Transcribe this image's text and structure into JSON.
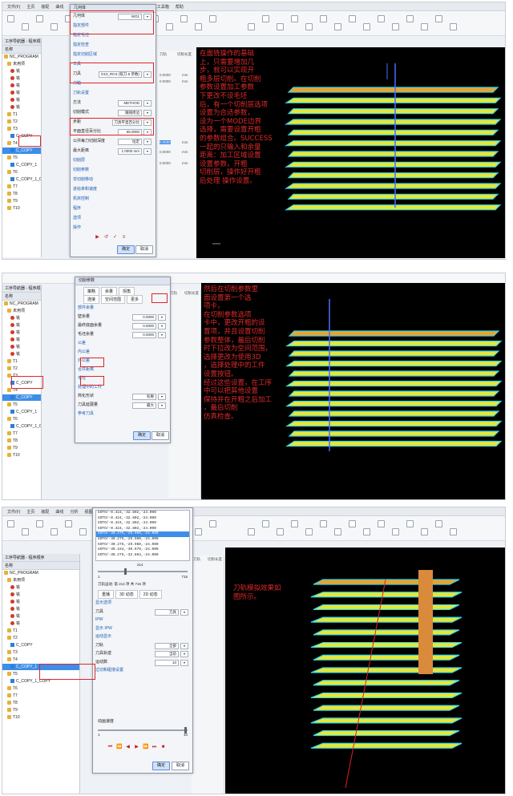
{
  "panel1": {
    "menus": [
      "文件(F)",
      "主页",
      "装配",
      "曲线",
      "分析",
      "视图",
      "渲染",
      "工具",
      "应用模块",
      "NX 工具箱",
      "帮助"
    ],
    "navigator": {
      "title": "工序导航器 - 程序顺序",
      "column": "名称",
      "items": [
        {
          "label": "NC_PROGRAM",
          "kind": "root"
        },
        {
          "label": "未用项",
          "kind": "fold"
        },
        {
          "label": "铣",
          "kind": "op"
        },
        {
          "label": "铣",
          "kind": "op"
        },
        {
          "label": "铣",
          "kind": "op"
        },
        {
          "label": "铣",
          "kind": "op"
        },
        {
          "label": "铣",
          "kind": "op"
        },
        {
          "label": "铣",
          "kind": "op"
        },
        {
          "label": "T1",
          "kind": "fold"
        },
        {
          "label": "T2",
          "kind": "fold"
        },
        {
          "label": "T3",
          "kind": "fold"
        },
        {
          "label": "C_COPY",
          "kind": "op"
        },
        {
          "label": "T4",
          "kind": "fold"
        },
        {
          "label": "C_COPY",
          "kind": "op",
          "selected": true
        },
        {
          "label": "T5",
          "kind": "fold"
        },
        {
          "label": "C_COPY_1",
          "kind": "op"
        },
        {
          "label": "T6",
          "kind": "fold"
        },
        {
          "label": "C_COPY_1_COPY",
          "kind": "op"
        },
        {
          "label": "T7",
          "kind": "fold"
        },
        {
          "label": "T8",
          "kind": "fold"
        },
        {
          "label": "T9",
          "kind": "fold"
        },
        {
          "label": "T10",
          "kind": "fold"
        }
      ]
    },
    "columns": [
      "刀轨",
      "切削长度"
    ],
    "col_values": [
      "0.0000",
      "0.0000",
      "0.0000",
      "0.0000",
      "0.0000",
      "0.0000"
    ],
    "col_units": [
      "mm",
      "mm",
      "mm",
      "mm",
      "mm",
      "mm"
    ],
    "dialog": {
      "title": "几何体",
      "rows": [
        {
          "label": "几何体",
          "value": "WO1"
        },
        {
          "label": "指定部件",
          "value": ""
        },
        {
          "label": "指定毛坯",
          "value": ""
        },
        {
          "label": "指定检查",
          "value": ""
        },
        {
          "label": "指定切削区域",
          "value": ""
        },
        {
          "label": "工具",
          "value": ""
        },
        {
          "label": "刀具",
          "value": "D10_R0.5 (铣刀-5 参数)"
        },
        {
          "label": "刀轴",
          "value": ""
        },
        {
          "label": "刀轨设置",
          "value": ""
        },
        {
          "label": "方法",
          "value": "METHOD"
        },
        {
          "label": "切削模式",
          "value": "跟随周边"
        },
        {
          "label": "步距",
          "value": "刀具平直百分比"
        },
        {
          "label": "平面直径百分比",
          "value": "65.0000"
        },
        {
          "label": "公共每刀切削深度",
          "value": "恒定"
        },
        {
          "label": "最大距离",
          "value": "1.0000 mm"
        },
        {
          "label": "切削层",
          "value": ""
        },
        {
          "label": "切削参数",
          "value": ""
        },
        {
          "label": "非切削移动",
          "value": ""
        },
        {
          "label": "进给率和速度",
          "value": ""
        },
        {
          "label": "机床控制",
          "value": ""
        },
        {
          "label": "程序",
          "value": ""
        },
        {
          "label": "选项",
          "value": ""
        },
        {
          "label": "操作",
          "value": ""
        }
      ],
      "ok": "确定",
      "cancel": "取消"
    },
    "note": "在面铣操作的基础\n上，只需要增加几\n步，就可以实现开\n粗多层切削。在切削\n参数设置加工参数\n下更改不设毛坯\n后，有一个切削层选项\n设置为合适参数，\n设为一个MODE边界\n选择，需要设置开粗\n的参数组合。SUCCESS\n一起的只输入和余量\n距离：加工区域设置\n设置参数，开粗\n切削层，操作好开粗\n后处理 操作设置。"
  },
  "panel2": {
    "navigator": {
      "title": "工序导航器 - 程序顺序",
      "column": "名称",
      "items": [
        {
          "label": "NC_PROGRAM",
          "kind": "root"
        },
        {
          "label": "未用项",
          "kind": "fold"
        },
        {
          "label": "铣",
          "kind": "op"
        },
        {
          "label": "铣",
          "kind": "op"
        },
        {
          "label": "铣",
          "kind": "op"
        },
        {
          "label": "铣",
          "kind": "op"
        },
        {
          "label": "铣",
          "kind": "op"
        },
        {
          "label": "铣",
          "kind": "op"
        },
        {
          "label": "T1",
          "kind": "fold"
        },
        {
          "label": "T2",
          "kind": "fold"
        },
        {
          "label": "T3",
          "kind": "fold"
        },
        {
          "label": "C_COPY",
          "kind": "op"
        },
        {
          "label": "T4",
          "kind": "fold"
        },
        {
          "label": "C_COPY",
          "kind": "op",
          "selected": true
        },
        {
          "label": "T5",
          "kind": "fold"
        },
        {
          "label": "C_COPY_1",
          "kind": "op"
        },
        {
          "label": "T6",
          "kind": "fold"
        },
        {
          "label": "C_COPY_1_COPY",
          "kind": "op"
        },
        {
          "label": "T7",
          "kind": "fold"
        },
        {
          "label": "T8",
          "kind": "fold"
        },
        {
          "label": "T9",
          "kind": "fold"
        },
        {
          "label": "T10",
          "kind": "fold"
        }
      ]
    },
    "columns": [
      "刀轨",
      "切削长度"
    ],
    "dialog": {
      "title": "切削参数",
      "tabs_row1": [
        "策略",
        "余量",
        "拐角"
      ],
      "tabs_row2": [
        "连接",
        "空间范围",
        "更多"
      ],
      "rows": [
        {
          "label": "部件余量",
          "value": ""
        },
        {
          "label": "壁余量",
          "value": "0.0000"
        },
        {
          "label": "最终底面余量",
          "value": "0.0000"
        },
        {
          "label": "毛坯余量",
          "value": "0.0000"
        },
        {
          "label": "公差",
          "value": ""
        },
        {
          "label": "内公差",
          "value": ""
        },
        {
          "label": "外公差",
          "value": ""
        },
        {
          "label": "合并距离",
          "value": ""
        },
        {
          "label": "毛坯",
          "value": ""
        },
        {
          "label": "处理中的工件",
          "value": ""
        },
        {
          "label": "简化形状",
          "value": "轮廓"
        },
        {
          "label": "刀具延展量",
          "value": "最大"
        },
        {
          "label": "参考刀具",
          "value": ""
        }
      ],
      "ok": "确定",
      "cancel": "取消"
    },
    "note": "然后在切削参数里\n面设置第一个选\n项卡，\n在切削参数选项\n卡中，更改开粗的设\n置项，并且设置切削\n参数整体，最后切削\n时下拉改为空间范围，\n选择更改为使用3D\n，选择处理中的工件\n设置按钮。\n经过这些设置，在工序\n中可以把其他设置\n保持并在开粗之后加工\n，最后切削\n仿真检查。"
  },
  "panel3": {
    "menus": [
      "文件(F)",
      "主页",
      "装配",
      "曲线",
      "分析",
      "视图",
      "渲染",
      "工具",
      "应用模块",
      "NX 工具箱",
      "帮助"
    ],
    "navigator": {
      "title": "工序导航器 - 程序顺序",
      "column": "名称",
      "items": [
        {
          "label": "NC_PROGRAM",
          "kind": "root"
        },
        {
          "label": "未用项",
          "kind": "fold"
        },
        {
          "label": "铣",
          "kind": "op"
        },
        {
          "label": "铣",
          "kind": "op"
        },
        {
          "label": "铣",
          "kind": "op"
        },
        {
          "label": "铣",
          "kind": "op"
        },
        {
          "label": "铣",
          "kind": "op"
        },
        {
          "label": "铣",
          "kind": "op"
        },
        {
          "label": "T1",
          "kind": "fold"
        },
        {
          "label": "T2",
          "kind": "fold"
        },
        {
          "label": "C_COPY",
          "kind": "op"
        },
        {
          "label": "T3",
          "kind": "fold"
        },
        {
          "label": "T4",
          "kind": "fold"
        },
        {
          "label": "C_COPY_1",
          "kind": "op",
          "selected": true
        },
        {
          "label": "T5",
          "kind": "fold"
        },
        {
          "label": "C_COPY_1_COPY",
          "kind": "op"
        },
        {
          "label": "T6",
          "kind": "fold"
        },
        {
          "label": "T7",
          "kind": "fold"
        },
        {
          "label": "T8",
          "kind": "fold"
        },
        {
          "label": "T9",
          "kind": "fold"
        },
        {
          "label": "T10",
          "kind": "fold"
        }
      ]
    },
    "columns": [
      "刀轨",
      "切削长度"
    ],
    "dialog": {
      "title": "刀轨可视化",
      "listing": [
        "GOTO/-0.424,-32.802,-24.000",
        "GOTO/-0.424,-32.802,-24.000",
        "GOTO/-0.424,-32.802,-24.000",
        "GOTO/-0.424,-32.802,-24.000",
        "GOTO/-30.275,-29.960,-24.000",
        "GOTO/-30.275,-29.960,-24.000",
        "GOTO/-30.275,-29.960,-24.000",
        "GOTO/-30.164,-30.679,-24.000",
        "GOTO/-30.275,-32.864,-24.000"
      ],
      "selected_index": 4,
      "slider_label": "214",
      "slider_min": "1",
      "slider_max": "715",
      "status": "刀轨运动: 第 214 项 共 715 项",
      "tabs": [
        "重播",
        "3D 动态",
        "2D 动态"
      ],
      "rows": [
        {
          "label": "显示选项",
          "value": ""
        },
        {
          "label": "刀具",
          "value": "刀具"
        },
        {
          "label": "IPW",
          "value": ""
        },
        {
          "label": "显示 IPW",
          "value": ""
        },
        {
          "label": "运动显示",
          "value": ""
        },
        {
          "label": "刀轨",
          "value": "全部"
        },
        {
          "label": "刀具轨迹",
          "value": "当前"
        },
        {
          "label": "运动数",
          "value": "10"
        },
        {
          "label": "过切和碰撞设置",
          "value": ""
        }
      ],
      "speed_label": "动画速度",
      "speed_min": "1",
      "speed_max": "10",
      "vcr": [
        "⏮",
        "⏪",
        "◀",
        "▶",
        "⏩",
        "⏭",
        "■"
      ],
      "ok": "确定",
      "cancel": "取消"
    },
    "note": "刀轨模拟效果如\n图所示。"
  },
  "colors": {
    "accent_red": "#e0242b",
    "selection_blue": "#3d8ee8",
    "viewport_bg": "#000000",
    "part_yellow": "#e8e636",
    "toolpath_cyan": "#33d6e6"
  }
}
